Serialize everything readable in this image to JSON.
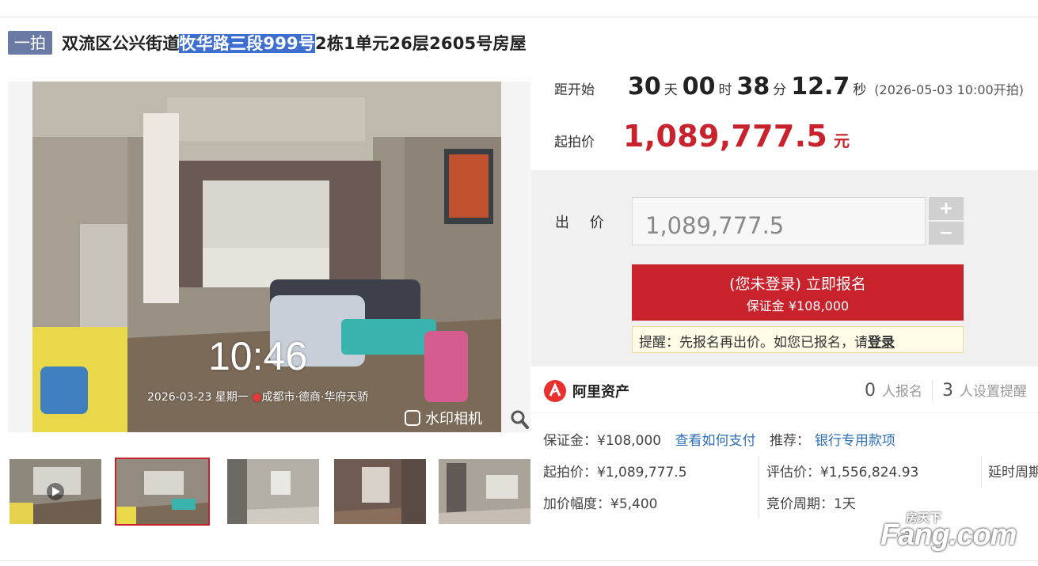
{
  "title": {
    "badge": "一拍",
    "prefix": "双流区公兴街道",
    "highlight": "牧华路三段999号",
    "suffix": "2栋1单元26层2605号房屋"
  },
  "photo": {
    "overlay_time": "10:46",
    "overlay_date": "2026-03-23 星期一",
    "overlay_location": "成都市·德商·华府天骄",
    "overlay_brand": "水印相机",
    "thumbnail_count": 5,
    "active_thumbnail": 2
  },
  "countdown": {
    "label": "距开始",
    "days": "30",
    "days_unit": "天",
    "hours": "00",
    "hours_unit": "时",
    "minutes": "38",
    "minutes_unit": "分",
    "seconds": "12.7",
    "seconds_unit": "秒",
    "start_note": "(2026-05-03 10:00开拍)"
  },
  "start_price": {
    "label": "起拍价",
    "value": "1,089,777.5",
    "unit": "元"
  },
  "bid": {
    "label": "出 价",
    "input_value": "1,089,777.5",
    "plus": "+",
    "minus": "−",
    "signup_line1": "(您未登录) 立即报名",
    "signup_line2": "保证金 ¥108,000",
    "reminder_text": "提醒：先报名再出价。如您已报名，请",
    "reminder_link": "登录"
  },
  "org": {
    "name": "阿里资产",
    "signups_num": "0",
    "signups_label": "人报名",
    "reminders_num": "3",
    "reminders_label": "人设置提醒"
  },
  "details": {
    "deposit": "保证金：¥108,000",
    "how_to_pay": "查看如何支付",
    "recommend_label": "推荐：",
    "recommend_link": "银行专用款项",
    "start_price": "起拍价：¥1,089,777.5",
    "appraisal": "评估价：¥1,556,824.93",
    "delay": "延时周期",
    "increment": "加价幅度：¥5,400",
    "cycle": "竞价周期：1天"
  },
  "watermark": {
    "top": "房天下",
    "brand": "Fang.com"
  },
  "colors": {
    "accent_red": "#c8232c",
    "badge_blue": "#6a7aa4",
    "link_blue": "#2f6fb5",
    "highlight_blue": "#3e6fd0"
  }
}
